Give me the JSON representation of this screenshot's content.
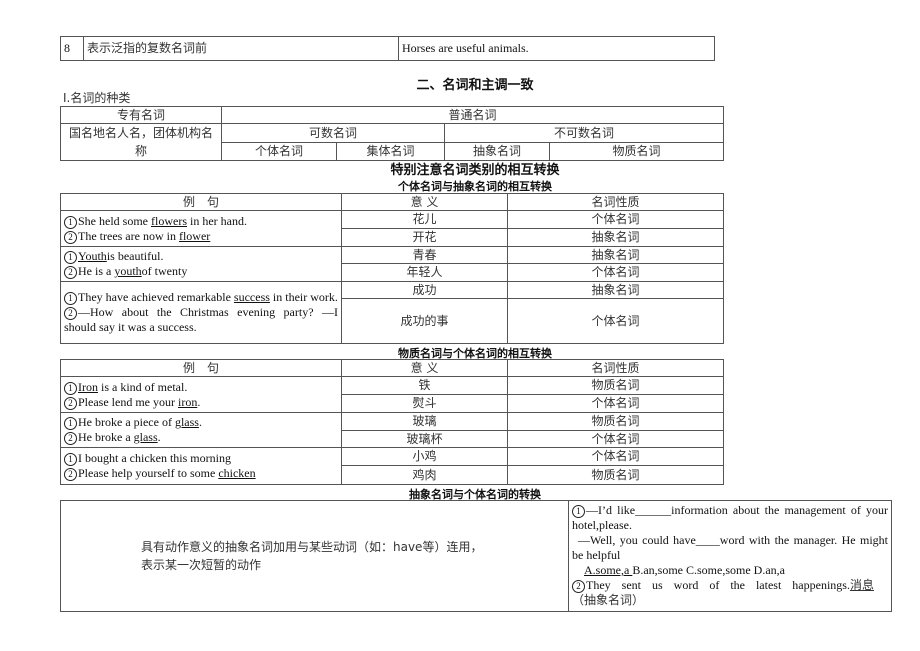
{
  "top_row": {
    "num": "8",
    "desc": "表示泛指的复数名词前",
    "example": "Horses are useful animals."
  },
  "section_title": "二、名词和主调一致",
  "subsection": "I.名词的种类",
  "kinds": {
    "proper": "专有名词",
    "common": "普通名词",
    "proper_desc": "国名地名人名，团体机构名称",
    "countable": "可数名词",
    "uncountable": "不可数名词",
    "individual": "个体名词",
    "collective": "集体名词",
    "abstract": "抽象名词",
    "material": "物质名词"
  },
  "note_title": "特别注意名词类别的相互转换",
  "headers": {
    "example": "例　句",
    "meaning": "意 义",
    "nature": "名词性质"
  },
  "table_a": {
    "title": "个体名词与抽象名词的相互转换",
    "groups": [
      {
        "sentences": [
          {
            "n": "1",
            "parts": [
              {
                "t": "She held some "
              },
              {
                "t": "flowers",
                "u": true
              },
              {
                "t": " in her hand."
              }
            ]
          },
          {
            "n": "2",
            "parts": [
              {
                "t": "The trees are now in "
              },
              {
                "t": "flower",
                "u": true
              }
            ]
          }
        ],
        "rows": [
          [
            "花儿",
            "个体名词"
          ],
          [
            "开花",
            "抽象名词"
          ]
        ]
      },
      {
        "sentences": [
          {
            "n": "1",
            "parts": [
              {
                "t": "Youth",
                "u": true
              },
              {
                "t": "is beautiful."
              }
            ]
          },
          {
            "n": "2",
            "parts": [
              {
                "t": "He is a "
              },
              {
                "t": "youth",
                "u": true
              },
              {
                "t": "of twenty"
              }
            ]
          }
        ],
        "rows": [
          [
            "青春",
            "抽象名词"
          ],
          [
            "年轻人",
            "个体名词"
          ]
        ]
      },
      {
        "sentences": [
          {
            "n": "1",
            "parts": [
              {
                "t": "They have achieved remarkable "
              },
              {
                "t": "success",
                "u": true
              },
              {
                "t": " in their work."
              }
            ]
          },
          {
            "n": "2",
            "parts": [
              {
                "t": "—How about the Christmas evening party? —I should say it was a success."
              }
            ]
          }
        ],
        "rows": [
          [
            "成功",
            "抽象名词"
          ],
          [
            "成功的事",
            "个体名词"
          ]
        ]
      }
    ]
  },
  "table_b": {
    "title": "物质名词与个体名词的相互转换",
    "groups": [
      {
        "sentences": [
          {
            "n": "1",
            "parts": [
              {
                "t": "Iron",
                "u": true
              },
              {
                "t": " is a kind of metal."
              }
            ]
          },
          {
            "n": "2",
            "parts": [
              {
                "t": "Please lend me your "
              },
              {
                "t": "iron",
                "u": true
              },
              {
                "t": "."
              }
            ]
          }
        ],
        "rows": [
          [
            "铁",
            "物质名词"
          ],
          [
            "熨斗",
            "个体名词"
          ]
        ]
      },
      {
        "sentences": [
          {
            "n": "1",
            "parts": [
              {
                "t": "He broke a piece of "
              },
              {
                "t": "glass",
                "u": true
              },
              {
                "t": "."
              }
            ]
          },
          {
            "n": "2",
            "parts": [
              {
                "t": "He broke a "
              },
              {
                "t": "glass",
                "u": true
              },
              {
                "t": "."
              }
            ]
          }
        ],
        "rows": [
          [
            "玻璃",
            "物质名词"
          ],
          [
            "玻璃杯",
            "个体名词"
          ]
        ]
      },
      {
        "sentences": [
          {
            "n": "1",
            "parts": [
              {
                "t": "I bought a chicken this morning"
              }
            ]
          },
          {
            "n": "2",
            "parts": [
              {
                "t": "Please help yourself to some "
              },
              {
                "t": "chicken",
                "u": true
              }
            ]
          }
        ],
        "rows": [
          [
            "小鸡",
            "个体名词"
          ],
          [
            "鸡肉",
            "物质名词"
          ]
        ]
      }
    ]
  },
  "table_c": {
    "title": "抽象名词与个体名词的转换",
    "left": "具有动作意义的抽象名词加用与某些动词（如：have等）连用，表示某一次短暂的动作",
    "q1_n": "1",
    "q1_line1": "—I’d like______information about the management of your hotel,please.",
    "q1_line2": "—Well, you could have____word with the manager. He might be helpful",
    "q1_answer": "A.some,a ",
    "q1_options": "B.an,some  C.some,some  D.an,a",
    "q2_n": "2",
    "q2_text": "They sent us word of the latest happenings.",
    "q2_u": "消息",
    "q2_note": "（抽象名词）"
  }
}
